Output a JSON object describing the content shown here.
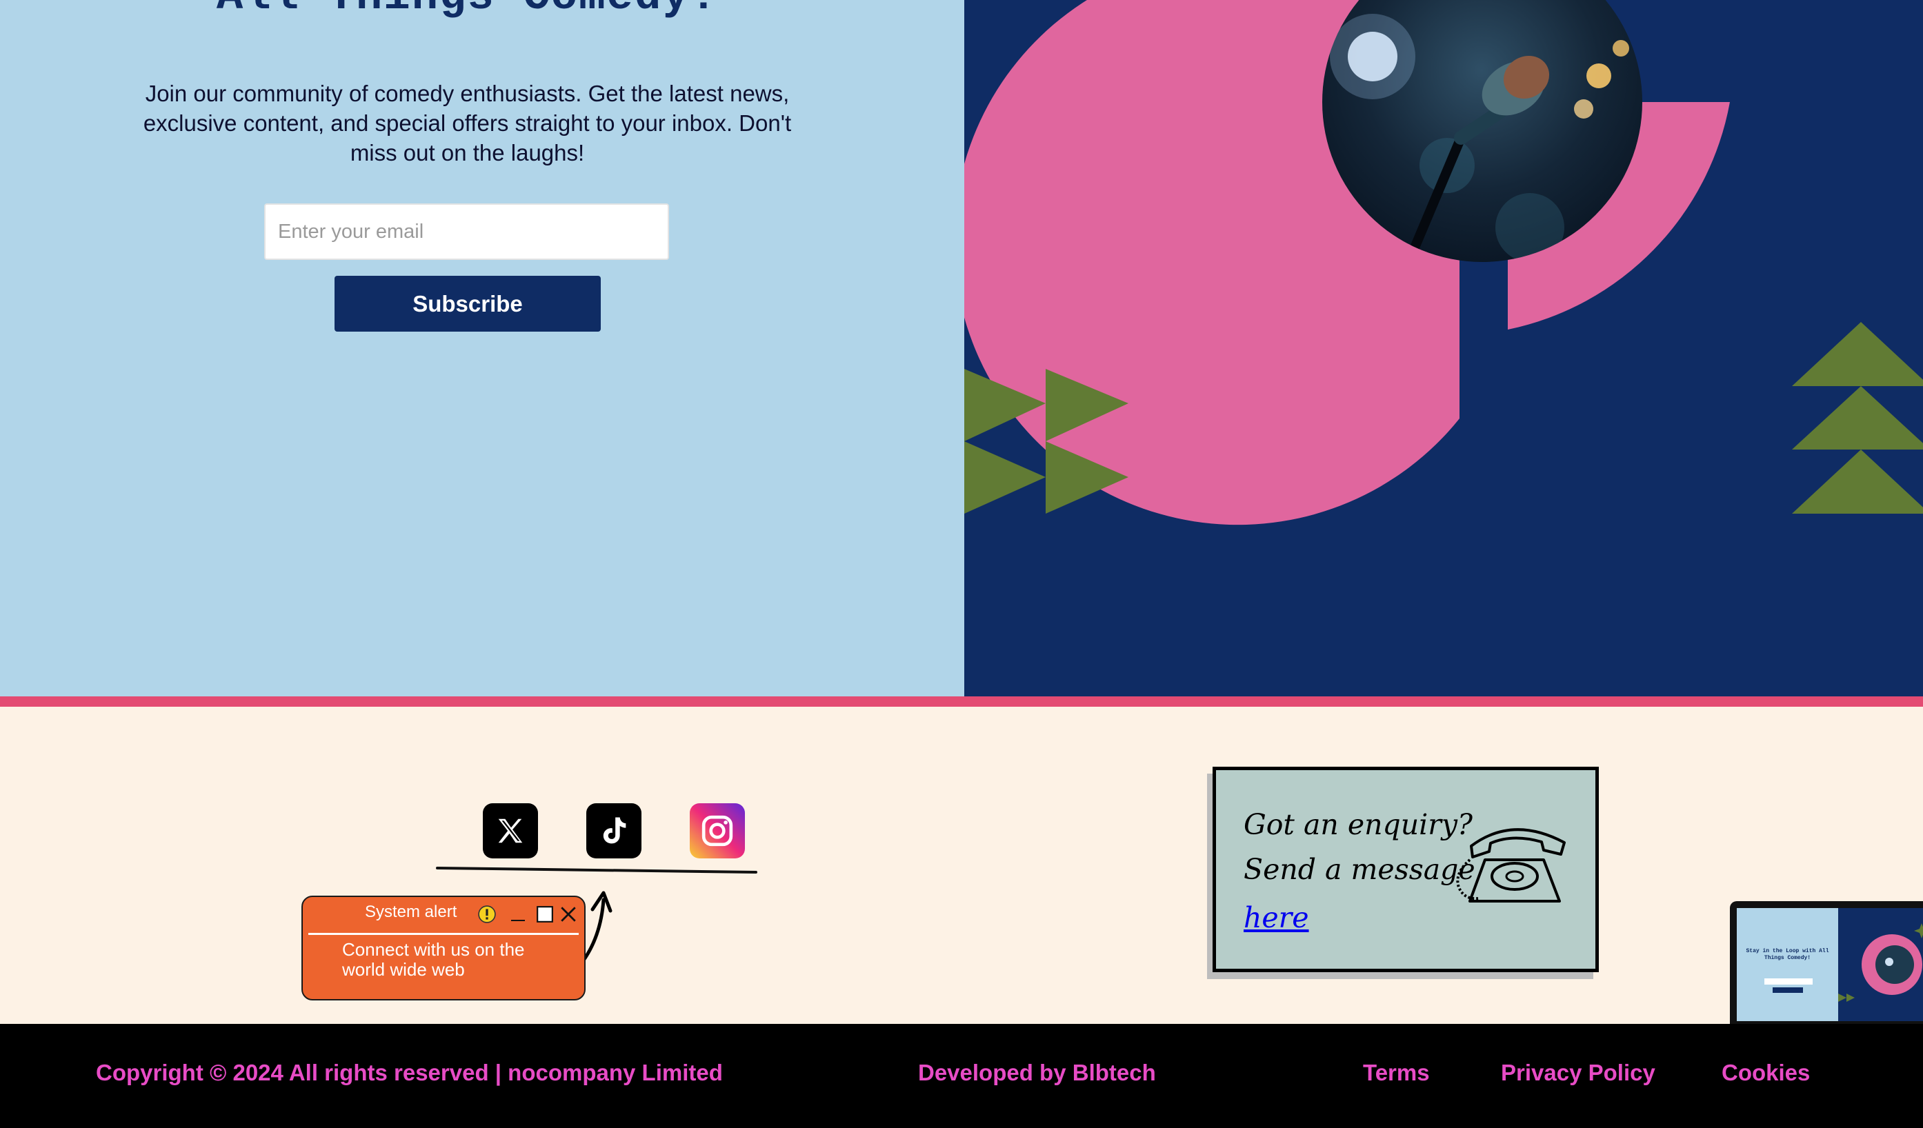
{
  "newsletter": {
    "heading": "All Things Comedy!",
    "intro": "Join our community of comedy enthusiasts. Get the latest news, exclusive content, and special offers straight to your inbox. Don't miss out on the laughs!",
    "email_placeholder": "Enter your email",
    "subscribe_label": "Subscribe"
  },
  "hero": {
    "image": "microphone-on-stage",
    "icons": [
      "green-arrow-triangles",
      "green-stacked-triangles",
      "pink-ring"
    ]
  },
  "social": {
    "icons": [
      "x-icon",
      "tiktok-icon",
      "instagram-icon"
    ]
  },
  "alert": {
    "title": "System alert",
    "body": "Connect with us on the world wide web",
    "icons": [
      "warning-icon",
      "minimize-icon",
      "maximize-icon",
      "close-icon"
    ]
  },
  "enquiry": {
    "line1": "Got an enquiry?",
    "line2": "Send a message",
    "link": "here",
    "icon": "telephone-icon"
  },
  "preview": {
    "heading": "Stay in the Loop with All Things Comedy!"
  },
  "footer": {
    "copyright": "Copyright © 2024 All rights reserved | nocompany Limited",
    "developer": "Developed by Blbtech",
    "links": [
      "Terms",
      "Privacy Policy",
      "Cookies"
    ]
  },
  "colors": {
    "light_blue": "#b1d5e9",
    "navy": "#0f2c64",
    "pink": "#e0669e",
    "green": "#617b34",
    "cream": "#fdf2e5",
    "divider": "#e34b72",
    "footer_text": "#e84cc6",
    "alert": "#ed642e"
  }
}
